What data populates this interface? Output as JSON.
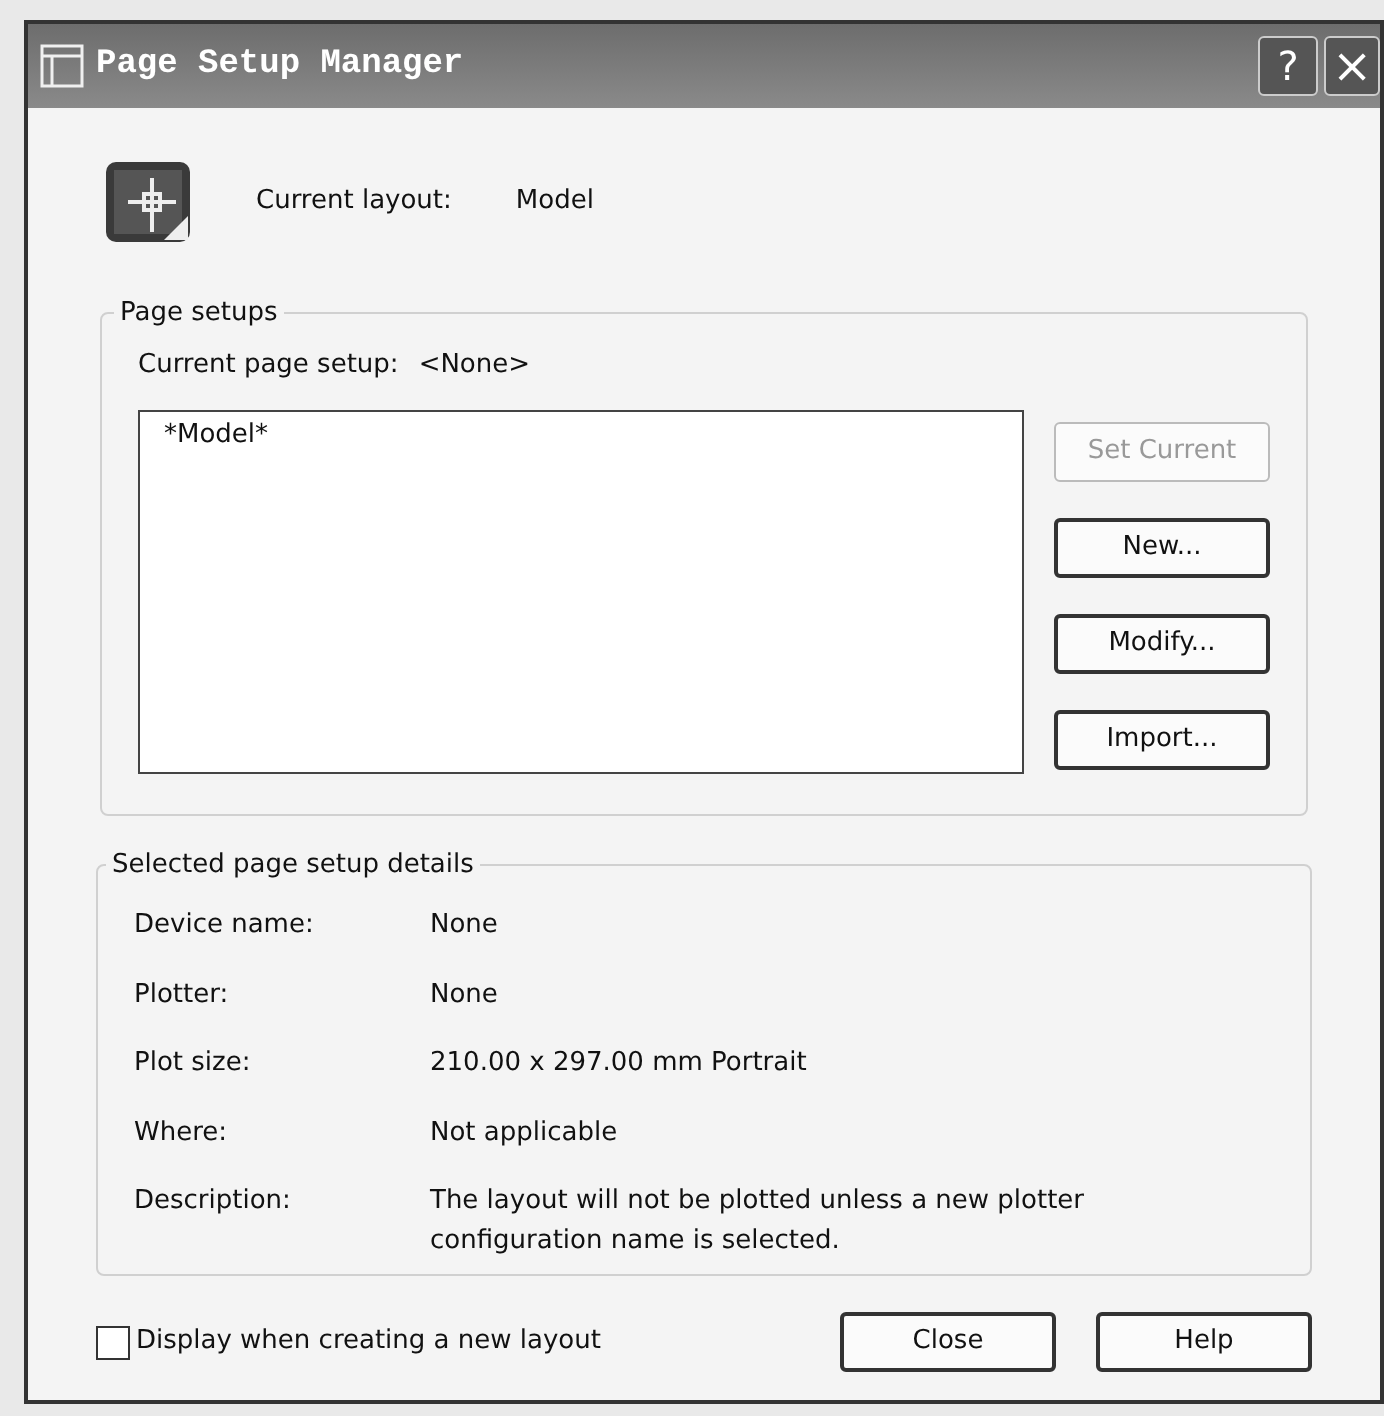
{
  "window": {
    "title": "Page Setup Manager",
    "help_button": "?",
    "close_button": "×"
  },
  "current_layout": {
    "label": "Current layout:",
    "value": "Model"
  },
  "page_setups": {
    "title": "Page setups",
    "current_label": "Current page setup:",
    "current_value": "<None>",
    "list": [
      "*Model*"
    ],
    "buttons": [
      {
        "label": "Set Current",
        "disabled": true
      },
      {
        "label": "New...",
        "disabled": false
      },
      {
        "label": "Modify...",
        "disabled": false
      },
      {
        "label": "Import...",
        "disabled": false
      }
    ]
  },
  "details": {
    "title": "Selected page setup details",
    "rows": [
      {
        "label": "Device name:",
        "value": "None"
      },
      {
        "label": "Plotter:",
        "value": "None"
      },
      {
        "label": "Plot size:",
        "value": "210.00 x 297.00 mm Portrait"
      },
      {
        "label": "Where:",
        "value": "Not applicable"
      },
      {
        "label": "Description:",
        "value": "The layout will not be plotted unless a new plotter configuration name is selected."
      }
    ]
  },
  "footer": {
    "checkbox": {
      "label": "Display when creating a new layout",
      "checked": false
    },
    "buttons": [
      "Close",
      "Help"
    ]
  }
}
